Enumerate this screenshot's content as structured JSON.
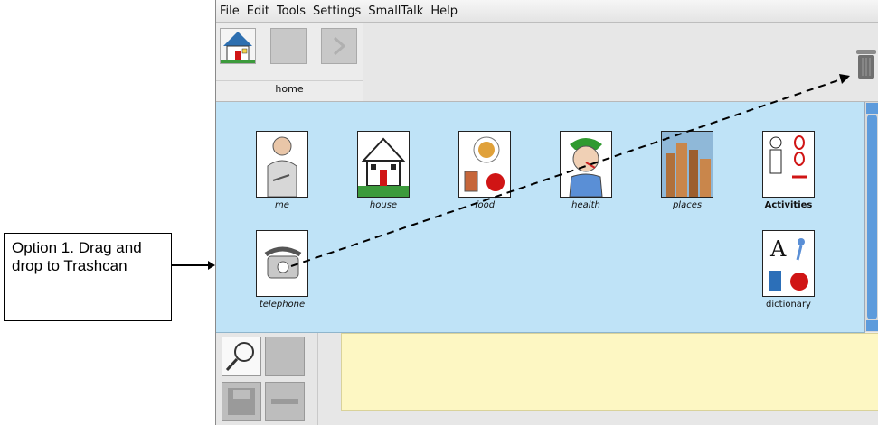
{
  "menu": [
    "File",
    "Edit",
    "Tools",
    "Settings",
    "SmallTalk",
    "Help"
  ],
  "nav": {
    "label": "home"
  },
  "grid": {
    "row1": [
      "me",
      "house",
      "food",
      "health",
      "places",
      "Activities"
    ],
    "row2": [
      "telephone",
      "dictionary"
    ]
  },
  "callout": {
    "bold": "Option 1",
    "text": ". Drag and drop to Trashcan"
  },
  "colors": {
    "grid": "#bfe3f7",
    "message": "#fdf7c3",
    "scroll": "#5d9bdc"
  }
}
